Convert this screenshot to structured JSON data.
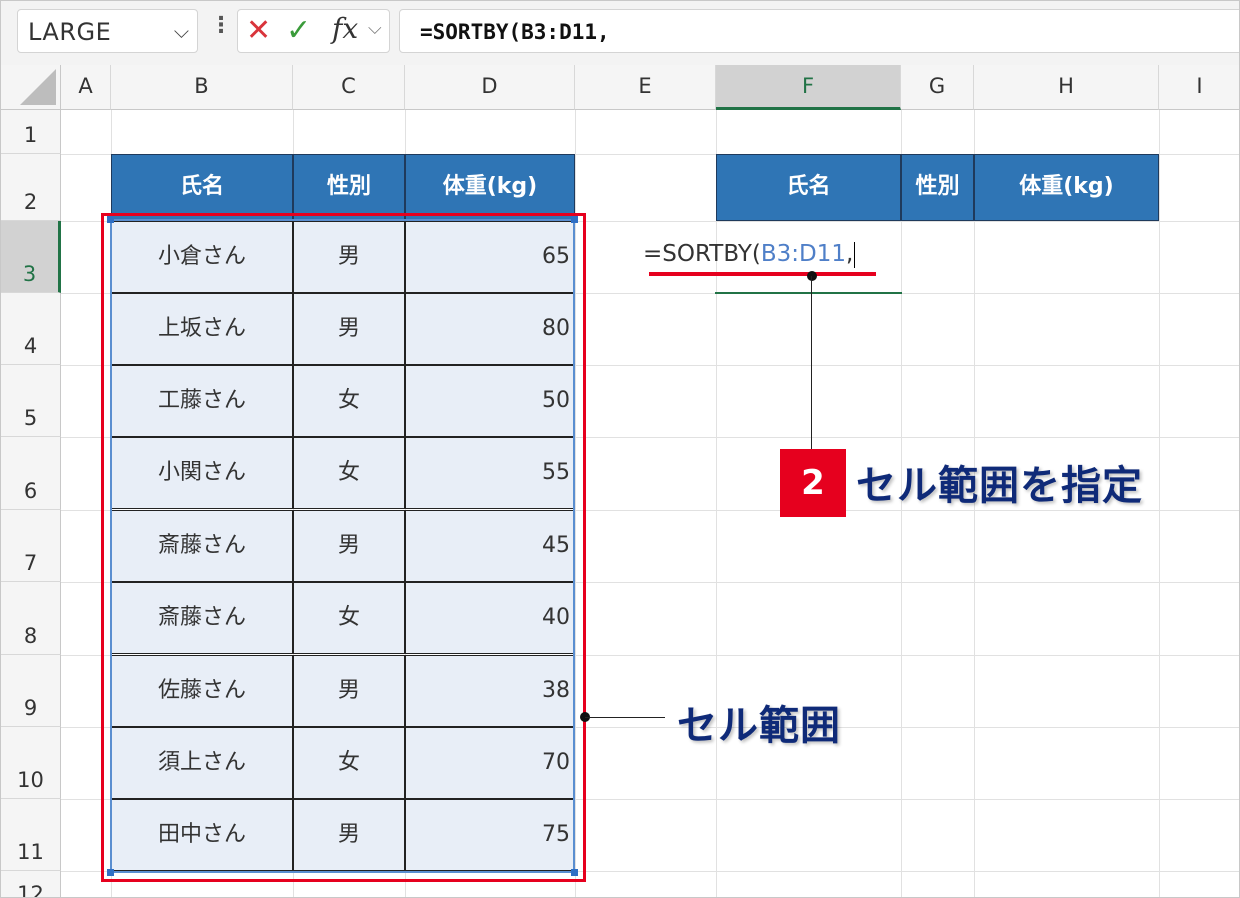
{
  "formula_bar": {
    "name_box": "LARGE",
    "name_box_arrow": "⌵",
    "separator": "⋮",
    "cancel": "✕",
    "enter": "✓",
    "fx": "fx",
    "fx_dropdown": "⌵",
    "formula": "=SORTBY(B3:D11,"
  },
  "columns": [
    "A",
    "B",
    "C",
    "D",
    "E",
    "F",
    "G",
    "H",
    "I"
  ],
  "rows": [
    "1",
    "2",
    "3",
    "4",
    "5",
    "6",
    "7",
    "8",
    "9",
    "10",
    "11",
    "12"
  ],
  "selected_column": "F",
  "selected_row": "3",
  "table": {
    "headers": [
      "氏名",
      "性別",
      "体重(kg)"
    ],
    "rows": [
      [
        "小倉さん",
        "男",
        "65"
      ],
      [
        "上坂さん",
        "男",
        "80"
      ],
      [
        "工藤さん",
        "女",
        "50"
      ],
      [
        "小関さん",
        "女",
        "55"
      ],
      [
        "斎藤さん",
        "男",
        "45"
      ],
      [
        "斎藤さん",
        "女",
        "40"
      ],
      [
        "佐藤さん",
        "男",
        "38"
      ],
      [
        "須上さん",
        "女",
        "70"
      ],
      [
        "田中さん",
        "男",
        "75"
      ]
    ]
  },
  "result_table": {
    "headers": [
      "氏名",
      "性別",
      "体重(kg)"
    ]
  },
  "cell_edit": {
    "prefix": "=SORTBY(",
    "ref": "B3:D11",
    "suffix": ","
  },
  "annotations": {
    "step_number": "2",
    "step_text": "セル範囲を指定",
    "range_label": "セル範囲"
  },
  "colors": {
    "header_fill": "#2f75b5",
    "cell_fill": "#e8eef7",
    "highlight_red": "#e6001e",
    "callout_text": "#0f2a78",
    "excel_green": "#217346"
  }
}
